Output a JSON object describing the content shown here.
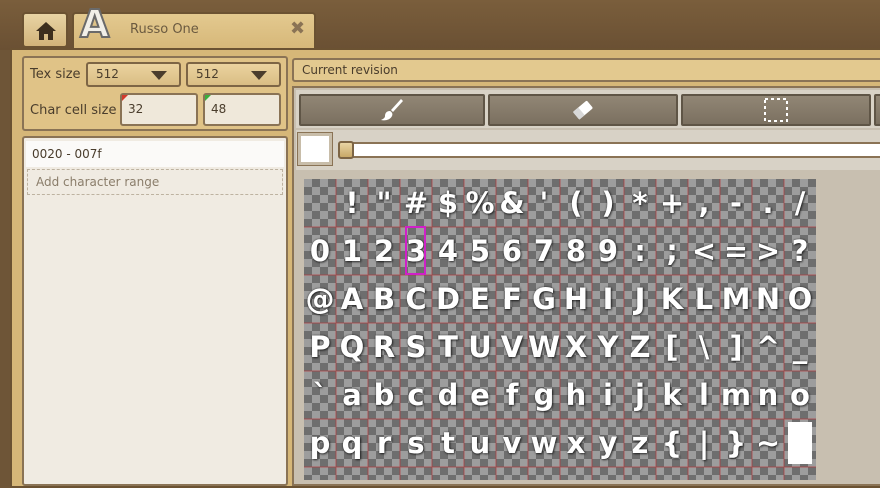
{
  "tab": {
    "title": "Russo One",
    "glyph": "A"
  },
  "settings": {
    "tex_size_label": "Tex size",
    "tex_width": "512",
    "tex_height": "512",
    "cell_size_label": "Char cell size",
    "cell_width": "32",
    "cell_height": "48"
  },
  "ranges": {
    "items": [
      "0020 - 007f"
    ],
    "add_label": "Add character range"
  },
  "revision": {
    "label": "Current revision"
  },
  "tools": [
    "brush-icon",
    "eraser-icon",
    "selection-icon"
  ],
  "colors": {
    "swatch": "#ffffff",
    "selection": "#d020c8",
    "frame": "#d6b778"
  },
  "atlas": {
    "rows": [
      [
        " ",
        "!",
        "\"",
        "#",
        "$",
        "%",
        "&",
        "'",
        "(",
        ")",
        "*",
        "+",
        ",",
        "-",
        ".",
        "/"
      ],
      [
        "0",
        "1",
        "2",
        "3",
        "4",
        "5",
        "6",
        "7",
        "8",
        "9",
        ":",
        ";",
        "<",
        "=",
        ">",
        "?"
      ],
      [
        "@",
        "A",
        "B",
        "C",
        "D",
        "E",
        "F",
        "G",
        "H",
        "I",
        "J",
        "K",
        "L",
        "M",
        "N",
        "O"
      ],
      [
        "P",
        "Q",
        "R",
        "S",
        "T",
        "U",
        "V",
        "W",
        "X",
        "Y",
        "Z",
        "[",
        "\\",
        "]",
        "^",
        "_"
      ],
      [
        "`",
        "a",
        "b",
        "c",
        "d",
        "e",
        "f",
        "g",
        "h",
        "i",
        "j",
        "k",
        "l",
        "m",
        "n",
        "o"
      ],
      [
        "p",
        "q",
        "r",
        "s",
        "t",
        "u",
        "v",
        "w",
        "x",
        "y",
        "z",
        "{",
        "|",
        "}",
        "~",
        ""
      ]
    ],
    "selected_char": "3"
  }
}
